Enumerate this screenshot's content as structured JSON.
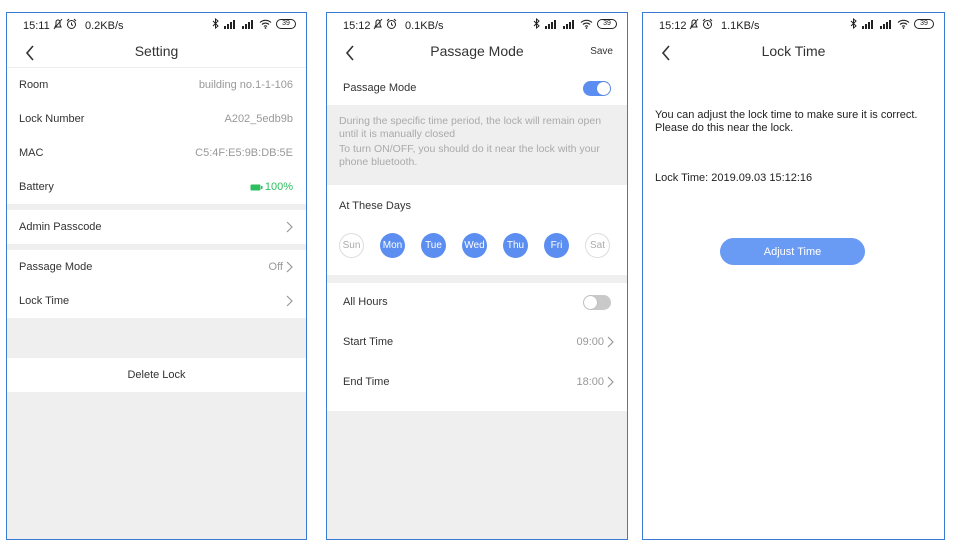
{
  "screens": [
    {
      "status": {
        "time": "15:11",
        "speed": "0.2KB/s",
        "battery": "39"
      },
      "title": "Setting",
      "rows": [
        {
          "label": "Room",
          "value": "building no.1-1-106"
        },
        {
          "label": "Lock Number",
          "value": "A202_5edb9b"
        },
        {
          "label": "MAC",
          "value": "C5:4F:E5:9B:DB:5E"
        },
        {
          "label": "Battery",
          "value": "100%"
        }
      ],
      "admin_passcode": "Admin Passcode",
      "passage_mode": {
        "label": "Passage Mode",
        "value": "Off"
      },
      "lock_time": "Lock Time",
      "delete_lock": "Delete Lock"
    },
    {
      "status": {
        "time": "15:12",
        "speed": "0.1KB/s",
        "battery": "39"
      },
      "title": "Passage Mode",
      "save": "Save",
      "passage_mode_label": "Passage Mode",
      "passage_mode_on": true,
      "note1": "During the specific time period, the lock will remain open until it is manually closed",
      "note2": "To turn ON/OFF, you should do it near the lock with your phone bluetooth.",
      "days_title": "At These Days",
      "days": [
        {
          "label": "Sun",
          "selected": false
        },
        {
          "label": "Mon",
          "selected": true
        },
        {
          "label": "Tue",
          "selected": true
        },
        {
          "label": "Wed",
          "selected": true
        },
        {
          "label": "Thu",
          "selected": true
        },
        {
          "label": "Fri",
          "selected": true
        },
        {
          "label": "Sat",
          "selected": false
        }
      ],
      "all_hours": "All Hours",
      "all_hours_on": false,
      "start_time": {
        "label": "Start Time",
        "value": "09:00"
      },
      "end_time": {
        "label": "End Time",
        "value": "18:00"
      }
    },
    {
      "status": {
        "time": "15:12",
        "speed": "1.1KB/s",
        "battery": "39"
      },
      "title": "Lock Time",
      "desc_line1": "You can adjust the lock time to make sure it is correct.",
      "desc_line2": "Please do this near the lock.",
      "lock_time_text": "Lock Time: 2019.09.03 15:12:16",
      "adjust_button": "Adjust Time"
    }
  ],
  "colors": {
    "accent": "#5b8ef0",
    "battery_green": "#2dbe60",
    "gap_gray": "#efefef",
    "frame_blue": "#3a7bd5"
  },
  "icons": [
    "back-chevron-icon",
    "chevron-right-icon",
    "alarm-icon",
    "bluetooth-icon",
    "signal-icon",
    "wifi-icon",
    "battery-icon",
    "mute-icon"
  ]
}
